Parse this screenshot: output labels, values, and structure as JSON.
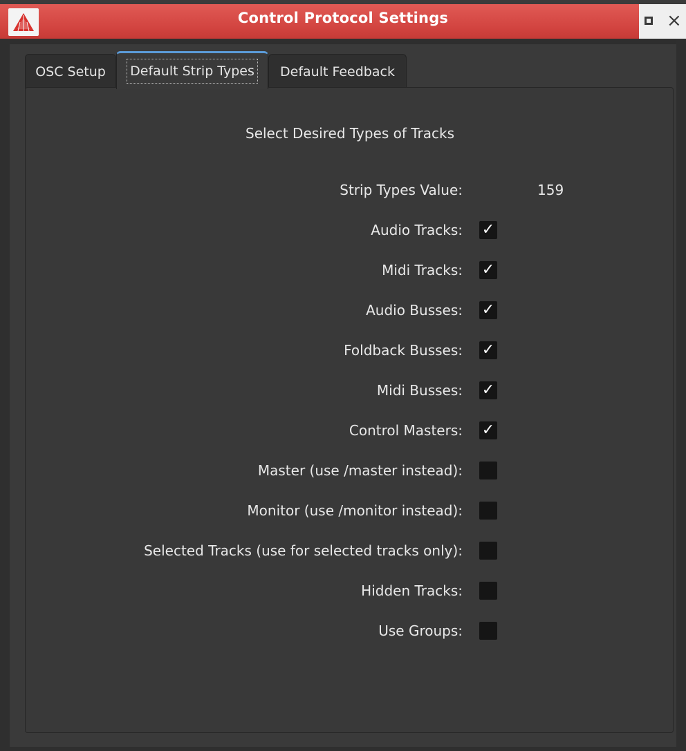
{
  "window": {
    "title": "Control Protocol Settings",
    "logo_icon": "app-logo-icon",
    "maximize_icon": "maximize-icon",
    "close_icon": "close-icon",
    "close_glyph": "×",
    "accent_color": "#d24440"
  },
  "tabs": [
    {
      "label": "OSC Setup",
      "active": false
    },
    {
      "label": "Default Strip Types",
      "active": true
    },
    {
      "label": "Default Feedback",
      "active": false
    }
  ],
  "panel": {
    "heading": "Select Desired Types of Tracks",
    "strip_value_label": "Strip Types Value:",
    "strip_value": "159",
    "options": [
      {
        "label": "Audio Tracks:",
        "checked": true
      },
      {
        "label": "Midi Tracks:",
        "checked": true
      },
      {
        "label": "Audio Busses:",
        "checked": true
      },
      {
        "label": "Foldback Busses:",
        "checked": true
      },
      {
        "label": "Midi Busses:",
        "checked": true
      },
      {
        "label": "Control Masters:",
        "checked": true
      },
      {
        "label": "Master (use /master instead):",
        "checked": false
      },
      {
        "label": "Monitor (use /monitor instead):",
        "checked": false
      },
      {
        "label": "Selected Tracks (use for selected tracks only):",
        "checked": false
      },
      {
        "label": "Hidden Tracks:",
        "checked": false
      },
      {
        "label": "Use Groups:",
        "checked": false
      }
    ],
    "check_glyph": "✓"
  }
}
